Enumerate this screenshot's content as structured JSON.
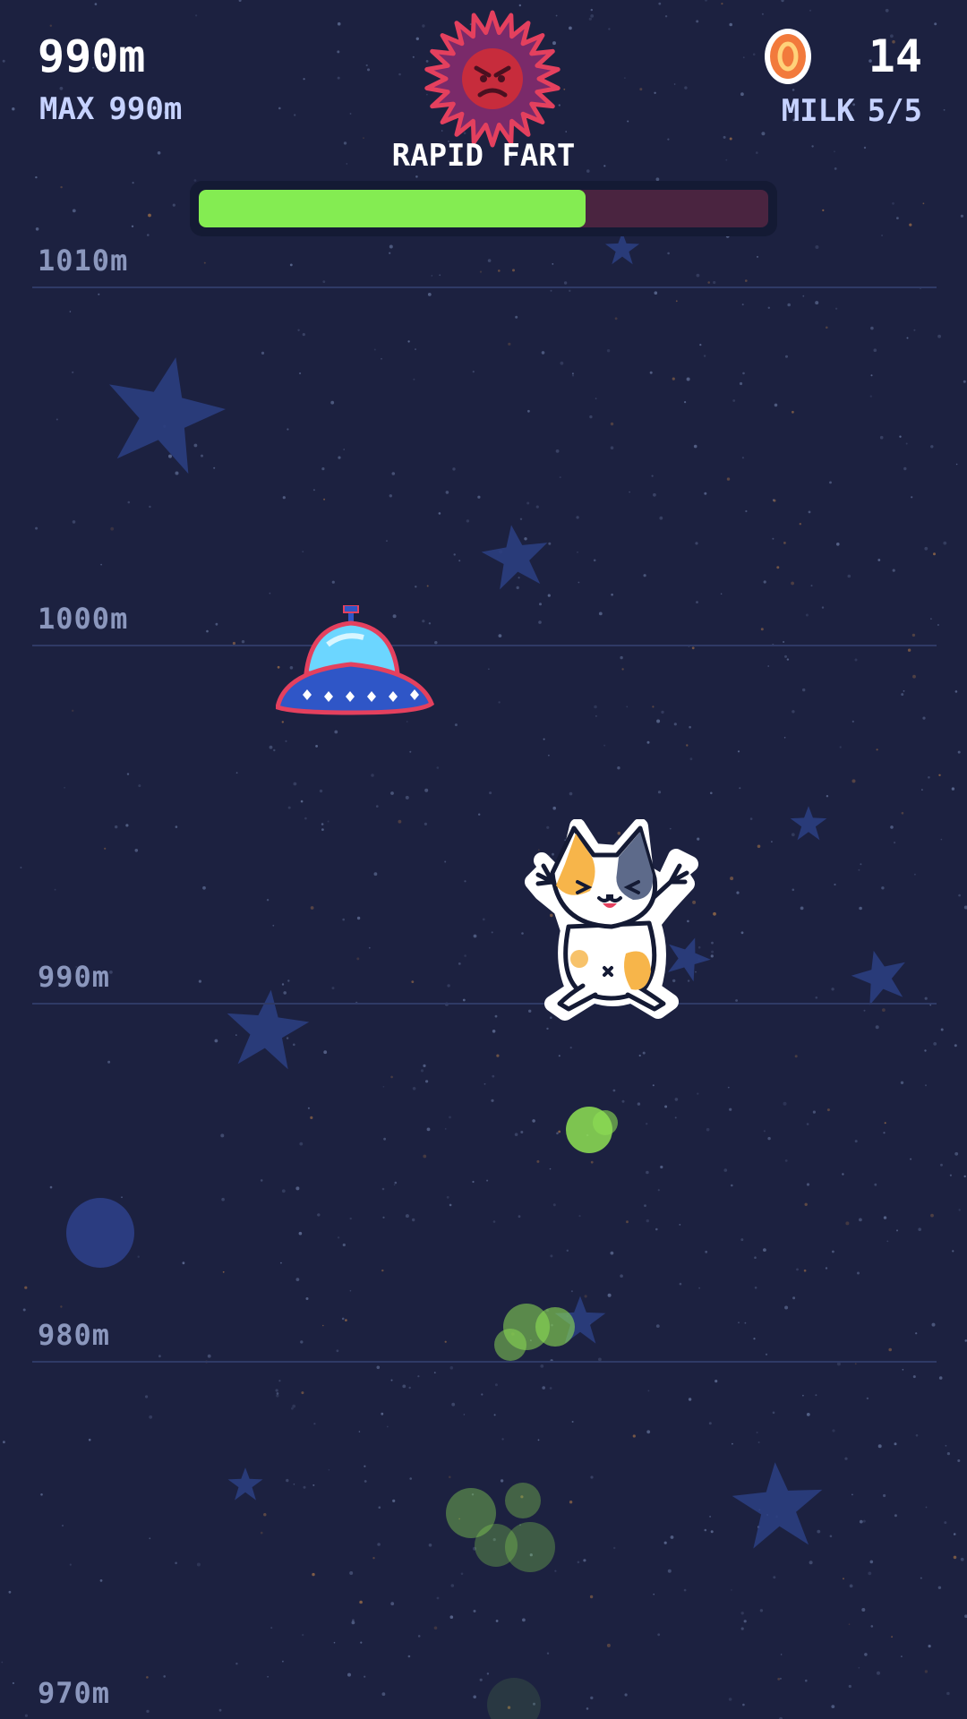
{
  "hud": {
    "distance": "990m",
    "max_label": "MAX",
    "max_value": "990m",
    "coins": "14",
    "milk_label": "MILK",
    "milk_value": "5/5"
  },
  "boss": {
    "title": "RAPID FART",
    "health_fraction": 0.68,
    "icon": "angry-spiky-virus-icon"
  },
  "altitude_markers": [
    {
      "label": "1010m"
    },
    {
      "label": "1000m"
    },
    {
      "label": "990m"
    },
    {
      "label": "980m"
    },
    {
      "label": "970m"
    }
  ],
  "colors": {
    "background": "#1c2140",
    "health_bar": "#84ec52",
    "health_track": "#4a2440",
    "fart_cloud": "#8ee054",
    "star": "#2c3f84"
  }
}
